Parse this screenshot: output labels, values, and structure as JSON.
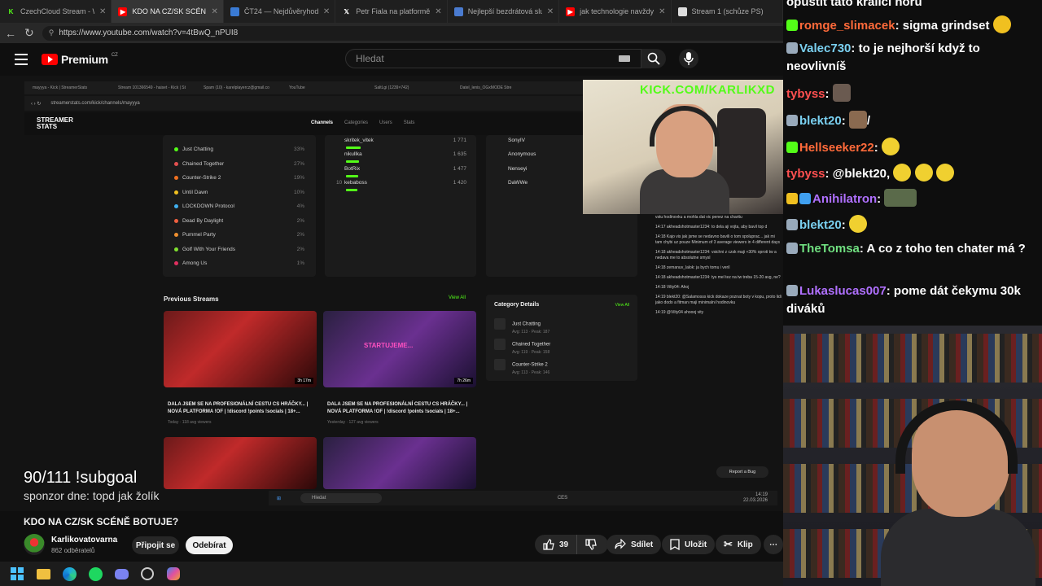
{
  "browser": {
    "tabs": [
      {
        "title": "CzechCloud Stream - Watch",
        "icon_color": "#53fc18",
        "icon": "kick-icon",
        "active": false
      },
      {
        "title": "KDO NA CZ/SK SCÉNĚ BOTUJE?",
        "icon_color": "#ff0000",
        "icon": "youtube-icon",
        "active": true
      },
      {
        "title": "ČT24 — Nejdůvěryhodnější",
        "icon_color": "#3a7bd5",
        "icon": "ct24-icon",
        "active": false
      },
      {
        "title": "Petr Fiala na platformě X: „10",
        "icon_color": "#ffffff",
        "icon": "x-icon",
        "active": false
      },
      {
        "title": "Nejlepší bezdrátová sluchátka",
        "icon_color": "#4a7bd0",
        "icon": "site-icon",
        "active": false
      },
      {
        "title": "jak technologie navždy mění",
        "icon_color": "#ff0000",
        "icon": "youtube-icon",
        "active": false
      },
      {
        "title": "Stream 1 (schůze PS)",
        "icon_color": "#dddddd",
        "icon": "page-icon",
        "active": false
      }
    ],
    "url": "https://www.youtube.com/watch?v=4tBwQ_nPUI8"
  },
  "youtube": {
    "logo_text": "Premium",
    "region": "CZ",
    "search_placeholder": "Hledat",
    "video_title": "KDO NA CZ/SK SCÉNĚ BOTUJE?",
    "channel_name": "Karlikovatovarna",
    "channel_subs": "862 odběratelů",
    "join_label": "Připojit se",
    "unsubscribe_label": "Odebírat",
    "like_count": "39",
    "share_label": "Sdílet",
    "save_label": "Uložit",
    "clip_label": "Klip"
  },
  "video": {
    "subgoal": "90/111 !subgoal",
    "sponsor": "sponzor dne: topd jak žolík",
    "kick_banner": "KICK.COM/KARLIKXD",
    "inner_tabs": [
      "mayyya - Kick | StreamerStats",
      "Stream 101366549 - haiset - Kick | St",
      "Spam (10) - karelplayercz@gmail.co",
      "YouTube",
      "SaltLgi (1239×742)",
      "Datel_lenis_OGxMODE Stre"
    ],
    "inner_url": "streamerstats.com/kick/channels/mayyya",
    "ss_logo_1": "STREAMER",
    "ss_logo_2": "STATS",
    "ss_nav": [
      "Channels",
      "Categories",
      "Users",
      "Stats"
    ],
    "categories": [
      {
        "name": "Just Chatting",
        "pct": "33%",
        "color": "#53fc18"
      },
      {
        "name": "Chained Together",
        "pct": "27%",
        "color": "#e35050"
      },
      {
        "name": "Counter-Strike 2",
        "pct": "19%",
        "color": "#f07020"
      },
      {
        "name": "Until Dawn",
        "pct": "10%",
        "color": "#f0c020"
      },
      {
        "name": "LOCKDOWN Protocol",
        "pct": "4%",
        "color": "#40b0f0"
      },
      {
        "name": "Dead By Daylight",
        "pct": "2%",
        "color": "#f06040"
      },
      {
        "name": "Pummel Party",
        "pct": "2%",
        "color": "#f09030"
      },
      {
        "name": "Golf With Your Friends",
        "pct": "2%",
        "color": "#80e030"
      },
      {
        "name": "Among Us",
        "pct": "1%",
        "color": "#e03060"
      }
    ],
    "top_chatters": [
      {
        "rank": "",
        "name": "skritek_vitek",
        "value": "1 771"
      },
      {
        "rank": "",
        "name": "nikullka",
        "value": "1 635"
      },
      {
        "rank": "",
        "name": "BotRix",
        "value": "1 477"
      },
      {
        "rank": "10",
        "name": "kebaboss",
        "value": "1 420"
      }
    ],
    "right_list": [
      "SonyIV",
      "Anonymous",
      "Nenseyi",
      "DaWWe"
    ],
    "previous_streams_label": "Previous Streams",
    "view_all_label": "View All",
    "streams": [
      {
        "title": "DALA JSEM SE NA PROFESIONÁLNÍ CESTU CS HRÁČKY... | NOVÁ PLATFORMA !OF | !discord !points !socials | 18+...",
        "meta": "Today · 118 avg viewers",
        "duration": "3h 17m"
      },
      {
        "title": "DALA JSEM SE NA PROFESIONÁLNÍ CESTU CS HRÁČKY... | NOVÁ PLATFORMA !OF | !discord !points !socials | 18+...",
        "meta": "Yesterday · 127 avg viewers",
        "duration": "7h 26m"
      }
    ],
    "stream2_overlay": "STARTUJEME...",
    "category_details_label": "Category Details",
    "category_details_view_all": "View All",
    "category_details": [
      {
        "name": "Just Chatting",
        "meta": "Avg: 113 · Peak: 187"
      },
      {
        "name": "Chained Together",
        "meta": "Avg: 119 · Peak: 158"
      },
      {
        "name": "Counter-Strike 2",
        "meta": "Avg: 113 · Peak: 146"
      }
    ],
    "kick_chat": [
      "vstu hodinovku a mohla dat vic penez na charitu",
      "14:17 akheadshotmaster1234: to dela aji vojta, aby bavil top d",
      "14:18 Kajo vis jak jsme se nedavno bavili o tom spoluprac... jak mi tam chybi uz pouze Minimum of 3 average viewers in 4 different days",
      "14:18 akheadshotmaster1234: vsichni z czsk maji +30% oproti tw a nedava me to absolutne smysl",
      "14:18 zemanuv_lalok: ja bych tomu i veril",
      "14:18 akheadshotmaster1234: tys mel tez na tw treba 15-20 avg, ne?",
      "14:18 Vilty04: Ahoj",
      "14:19 blekt20: @Salamosss kick dokaze poznat boty v kopu, proto lidi jako dodo a fitman maji minimalni hodinovku",
      "14:19 @Vilty04 ahoooj vity"
    ],
    "report_bug": "Report a Bug",
    "inner_search": "Hledat",
    "inner_lang": "CES",
    "inner_time": "14:19",
    "inner_date": "22.03.2026"
  },
  "twitch_chat": [
    {
      "user": "",
      "text": "opustit tato kralici noru",
      "color": "#ffffff"
    },
    {
      "user": "romge_slimacek",
      "text": "sigma grindset",
      "color": "#ff6a3a",
      "emote": "cool-emote"
    },
    {
      "user": "Valec730",
      "text": "to je nejhorší když to neovlivníš",
      "color": "#7ad0f0"
    },
    {
      "user": "tybyss",
      "text": "",
      "color": "#ff5050",
      "emote": "face-emote"
    },
    {
      "user": "blekt20",
      "text": "/",
      "color": "#7ad0f0",
      "emote": "face-emote"
    },
    {
      "user": "Hellseeker22",
      "text": "",
      "color": "#ff6a3a",
      "emote": "ok-emote"
    },
    {
      "user": "tybyss",
      "text": "@blekt20,",
      "color": "#ff5050",
      "emote": "clap-emote"
    },
    {
      "user": "Anihilatron",
      "text": "",
      "color": "#b070ff",
      "emote": "frog-emote"
    },
    {
      "user": "blekt20",
      "text": "",
      "color": "#7ad0f0",
      "emote": "hat-emote"
    },
    {
      "user": "TheTomsa",
      "text": "A co z toho ten chater má ?",
      "color": "#70e080"
    },
    {
      "user": "Lukaslucas007",
      "text": "pome dát čekymu 30k diváků",
      "color": "#b070ff"
    }
  ],
  "colors": {
    "kick_green": "#53fc18",
    "yt_red": "#ff0000"
  }
}
